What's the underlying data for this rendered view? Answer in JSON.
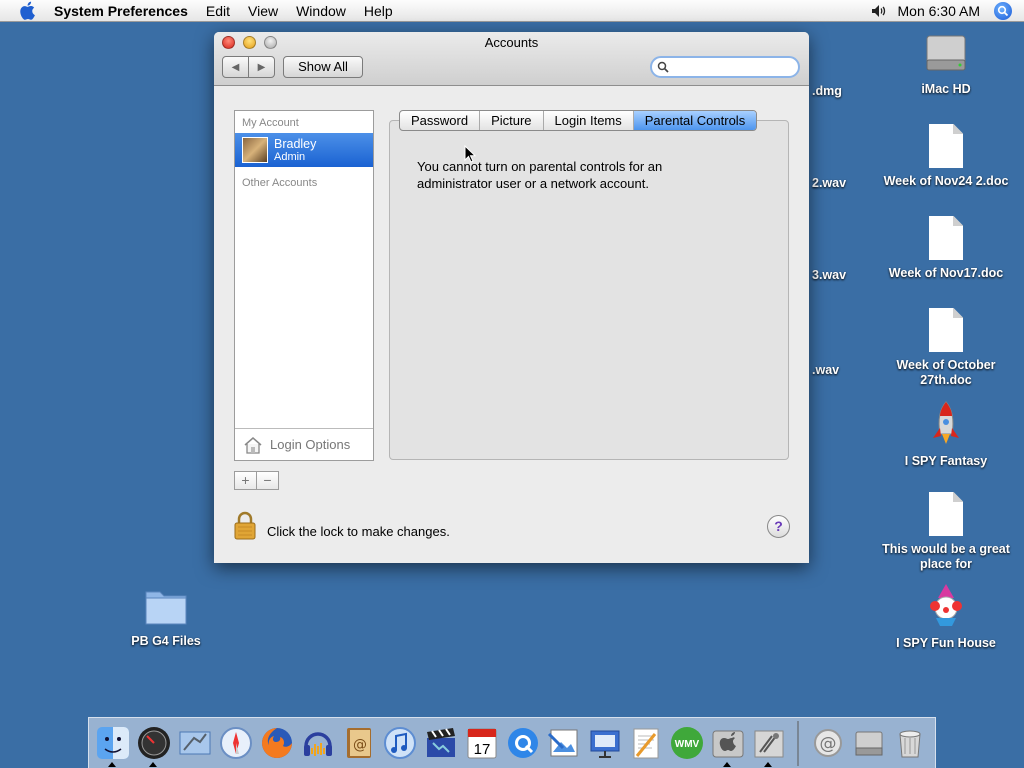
{
  "menubar": {
    "app_name": "System Preferences",
    "items": [
      "Edit",
      "View",
      "Window",
      "Help"
    ],
    "clock": "Mon 6:30 AM"
  },
  "desktop": {
    "icons": [
      {
        "name": "hd",
        "label": "iMac HD"
      },
      {
        "name": "doc1",
        "label": "Week of Nov24 2.doc"
      },
      {
        "name": "doc2",
        "label": "Week of Nov17.doc"
      },
      {
        "name": "doc3",
        "label": "Week of October 27th.doc"
      },
      {
        "name": "app1",
        "label": "I SPY Fantasy"
      },
      {
        "name": "doc4",
        "label": "This would be a great place for"
      },
      {
        "name": "app2",
        "label": "I SPY Fun House"
      },
      {
        "name": "folder",
        "label": "PB G4 Files"
      }
    ],
    "partial_labels": [
      ".dmg",
      "2.wav",
      "3.wav",
      ".wav"
    ]
  },
  "window": {
    "title": "Accounts",
    "show_all": "Show All",
    "search_placeholder": "",
    "sidebar": {
      "my_account_header": "My Account",
      "account_name": "Bradley",
      "account_role": "Admin",
      "other_accounts_header": "Other Accounts",
      "login_options": "Login Options",
      "add": "+",
      "remove": "−"
    },
    "tabs": [
      "Password",
      "Picture",
      "Login Items",
      "Parental Controls"
    ],
    "selected_tab": "Parental Controls",
    "message": "You cannot turn on parental controls for an administrator user or a network account.",
    "lock_text": "Click the lock to make changes.",
    "help": "?"
  },
  "dock": {
    "calendar_day": "17",
    "wmv_label": "WMV"
  },
  "colors": {
    "desktop": "#3a6ea5",
    "selection": "#1a62d2",
    "tab_selected": "#4e95ee"
  }
}
